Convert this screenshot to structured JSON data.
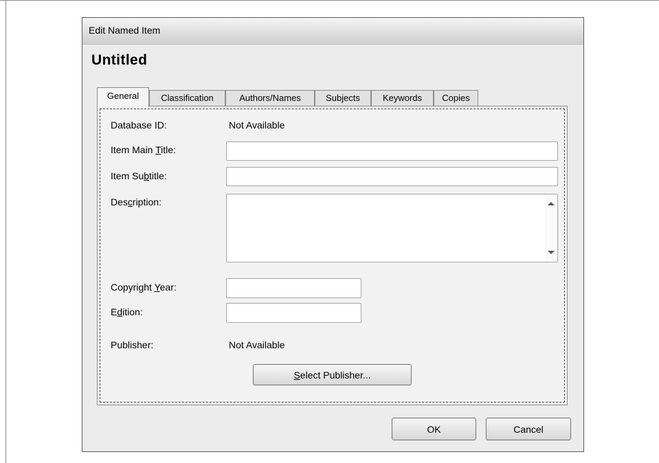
{
  "window": {
    "title": "Edit Named Item"
  },
  "heading": "Untitled",
  "tabs": [
    {
      "label": "General",
      "active": true
    },
    {
      "label": "Classification",
      "active": false
    },
    {
      "label": "Authors/Names",
      "active": false
    },
    {
      "label": "Subjects",
      "active": false
    },
    {
      "label": "Keywords",
      "active": false
    },
    {
      "label": "Copies",
      "active": false
    }
  ],
  "general": {
    "database_id": {
      "label": "Database ID:",
      "value": "Not Available"
    },
    "main_title": {
      "label_pre": "Item Main ",
      "label_key": "T",
      "label_post": "itle:",
      "value": ""
    },
    "subtitle": {
      "label_pre": "Item Su",
      "label_key": "b",
      "label_post": "title:",
      "value": ""
    },
    "description": {
      "label_pre": "Des",
      "label_key": "c",
      "label_post": "ription:",
      "value": ""
    },
    "copyright_year": {
      "label_pre": "Copyright ",
      "label_key": "Y",
      "label_post": "ear:",
      "value": ""
    },
    "edition": {
      "label_pre": "E",
      "label_key": "d",
      "label_post": "ition:",
      "value": ""
    },
    "publisher": {
      "label": "Publisher:",
      "value": "Not Available"
    },
    "select_publisher": {
      "label_key": "S",
      "label_post": "elect Publisher..."
    }
  },
  "footer": {
    "ok_label": "OK",
    "cancel_label": "Cancel"
  }
}
